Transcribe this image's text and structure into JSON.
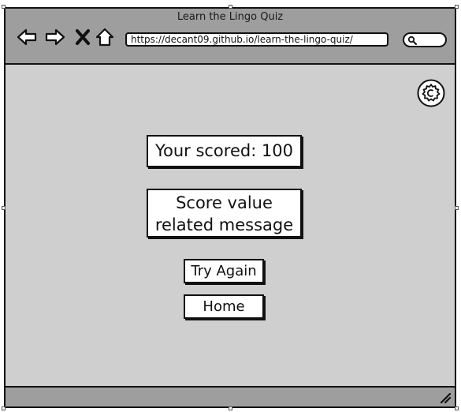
{
  "window": {
    "title": "Learn the Lingo Quiz"
  },
  "toolbar": {
    "url": "https://decant09.github.io/learn-the-lingo-quiz/",
    "icons": [
      "back-icon",
      "forward-icon",
      "close-icon",
      "home-icon",
      "search-icon"
    ]
  },
  "main": {
    "settings_icon": "gear-icon",
    "score_text": "Your scored: 100",
    "message_line1": "Score value",
    "message_line2": "related message",
    "try_again_label": "Try Again",
    "home_label": "Home"
  }
}
